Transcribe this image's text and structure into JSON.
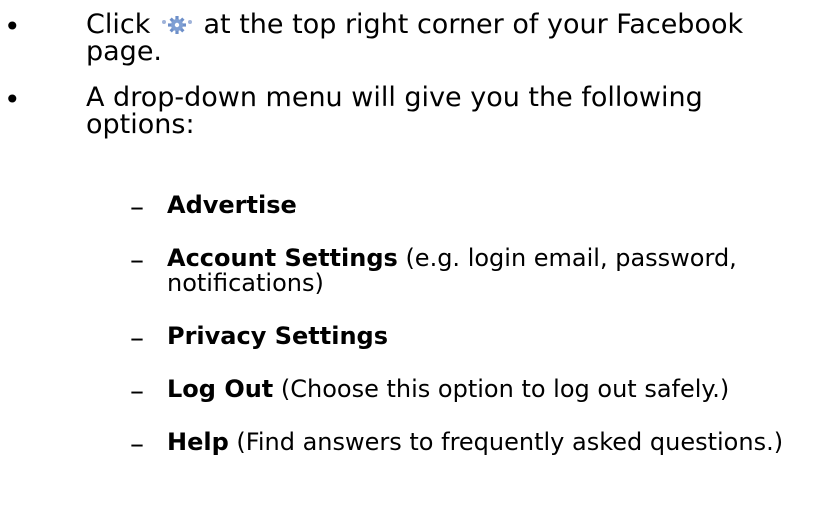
{
  "bullets": [
    {
      "symbol": "•",
      "text_before_icon": "Click ",
      "icon": "gear-icon",
      "text_after_icon": " at the top right corner of your Facebook page."
    },
    {
      "symbol": "•",
      "text": "A drop-down menu will give you the following options:"
    }
  ],
  "options": [
    {
      "dash": "–",
      "bold": "Advertise",
      "rest": ""
    },
    {
      "dash": "–",
      "bold": "Account Settings",
      "rest": " (e.g. login email, password, notifications)"
    },
    {
      "dash": "–",
      "bold": "Privacy Settings",
      "rest": ""
    },
    {
      "dash": "–",
      "bold": "Log Out",
      "rest": " (Choose this option to log out safely.)"
    },
    {
      "dash": "–",
      "bold": "Help",
      "rest": " (Find answers to frequently asked questions.)"
    }
  ],
  "colors": {
    "text": "#000000",
    "gear_icon": "#6d8fc9"
  }
}
